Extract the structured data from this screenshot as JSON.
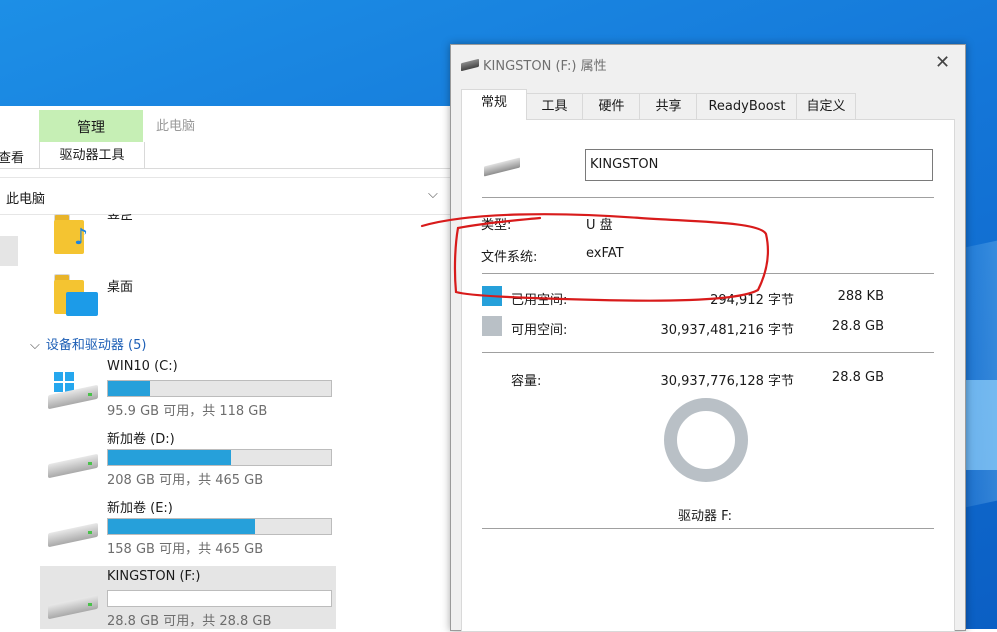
{
  "explorer": {
    "ribbon": {
      "context_label": "管理",
      "window_title": "此电脑",
      "tab_view": "查看",
      "tab_drive_tools": "驱动器工具"
    },
    "address": "此电脑",
    "folders": [
      {
        "label": "音乐"
      },
      {
        "label": "桌面"
      }
    ],
    "group_header": "设备和驱动器 (5)",
    "drives": [
      {
        "name": "WIN10 (C:)",
        "free": "95.9 GB 可用，共 118 GB",
        "used_fraction": 0.19
      },
      {
        "name": "新加卷 (D:)",
        "free": "208 GB 可用，共 465 GB",
        "used_fraction": 0.55
      },
      {
        "name": "新加卷 (E:)",
        "free": "158 GB 可用，共 465 GB",
        "used_fraction": 0.66
      },
      {
        "name": "KINGSTON (F:)",
        "free": "28.8 GB 可用，共 28.8 GB",
        "used_fraction": 0.0
      }
    ]
  },
  "dialog": {
    "title": "KINGSTON (F:) 属性",
    "close_glyph": "✕",
    "tabs": [
      "常规",
      "工具",
      "硬件",
      "共享",
      "ReadyBoost",
      "自定义"
    ],
    "name_value": "KINGSTON",
    "type_label": "类型:",
    "type_value": "U 盘",
    "fs_label": "文件系统:",
    "fs_value": "exFAT",
    "used_label": "已用空间:",
    "used_bytes": "294,912 字节",
    "used_size": "288 KB",
    "free_label": "可用空间:",
    "free_bytes": "30,937,481,216 字节",
    "free_size": "28.8 GB",
    "capacity_label": "容量:",
    "capacity_bytes": "30,937,776,128 字节",
    "capacity_size": "28.8 GB",
    "drive_label": "驱动器 F:",
    "used_color": "#26a0da",
    "free_color": "#b9c0c6"
  },
  "annotation_color": "#d81b1b"
}
